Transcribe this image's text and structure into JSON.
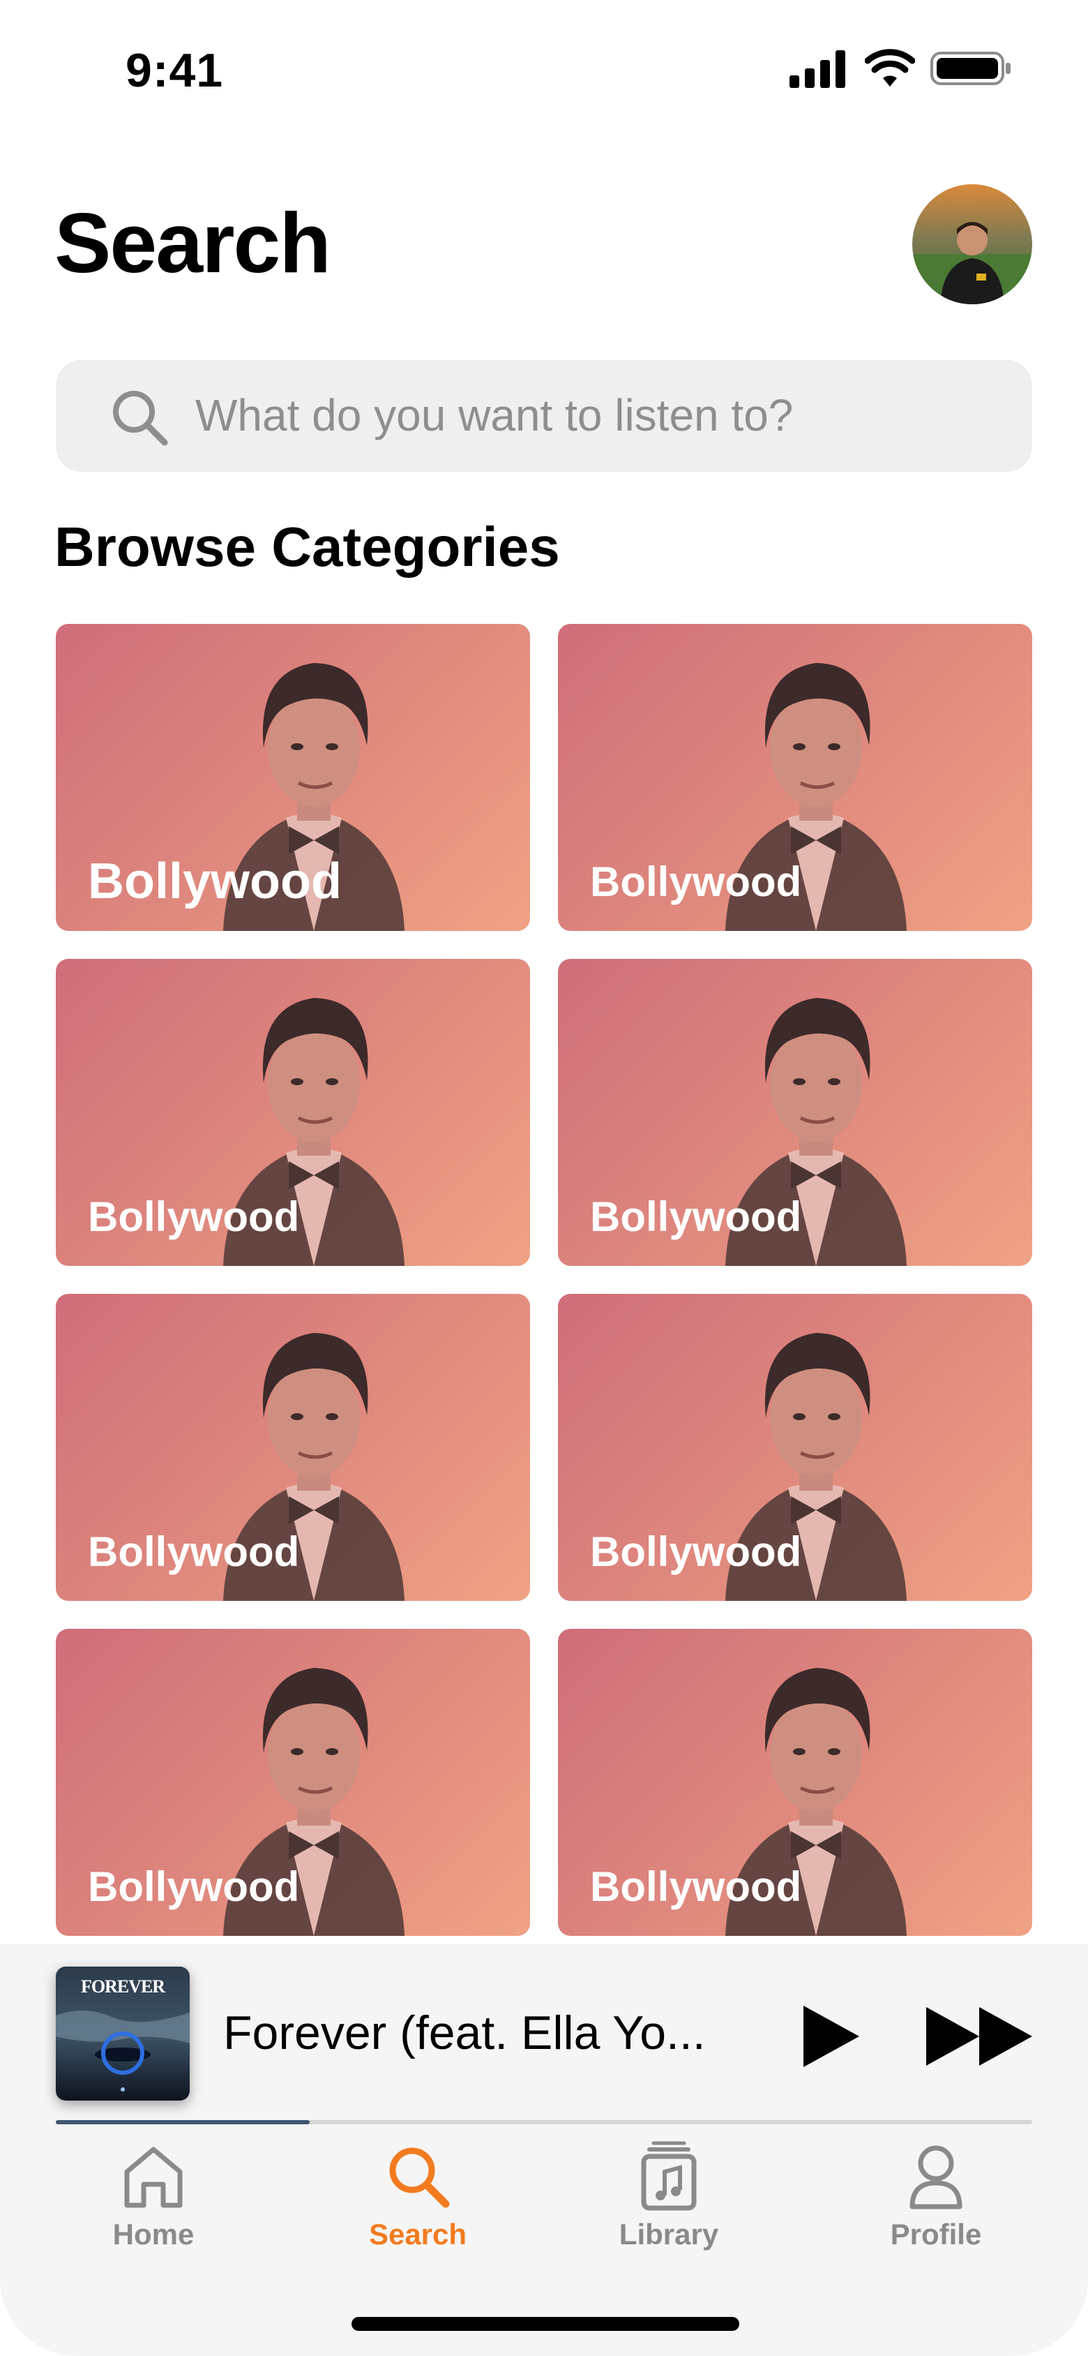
{
  "status": {
    "time": "9:41"
  },
  "header": {
    "title": "Search"
  },
  "search": {
    "placeholder": "What do you want to listen to?"
  },
  "browse": {
    "title": "Browse Categories",
    "categories": [
      {
        "label": "Bollywood"
      },
      {
        "label": "Bollywood"
      },
      {
        "label": "Bollywood"
      },
      {
        "label": "Bollywood"
      },
      {
        "label": "Bollywood"
      },
      {
        "label": "Bollywood"
      },
      {
        "label": "Bollywood"
      },
      {
        "label": "Bollywood"
      }
    ]
  },
  "player": {
    "album_art_text": "FOREVER",
    "track_title": "Forever (feat. Ella Yo...",
    "progress": 0.26
  },
  "tabs": [
    {
      "label": "Home",
      "icon": "home-icon",
      "active": false
    },
    {
      "label": "Search",
      "icon": "search-icon",
      "active": true
    },
    {
      "label": "Library",
      "icon": "library-icon",
      "active": false
    },
    {
      "label": "Profile",
      "icon": "profile-icon",
      "active": false
    }
  ],
  "colors": {
    "accent": "#f27b1f",
    "card_gradient_start": "#cf6d7a",
    "card_gradient_end": "#f0a283"
  }
}
